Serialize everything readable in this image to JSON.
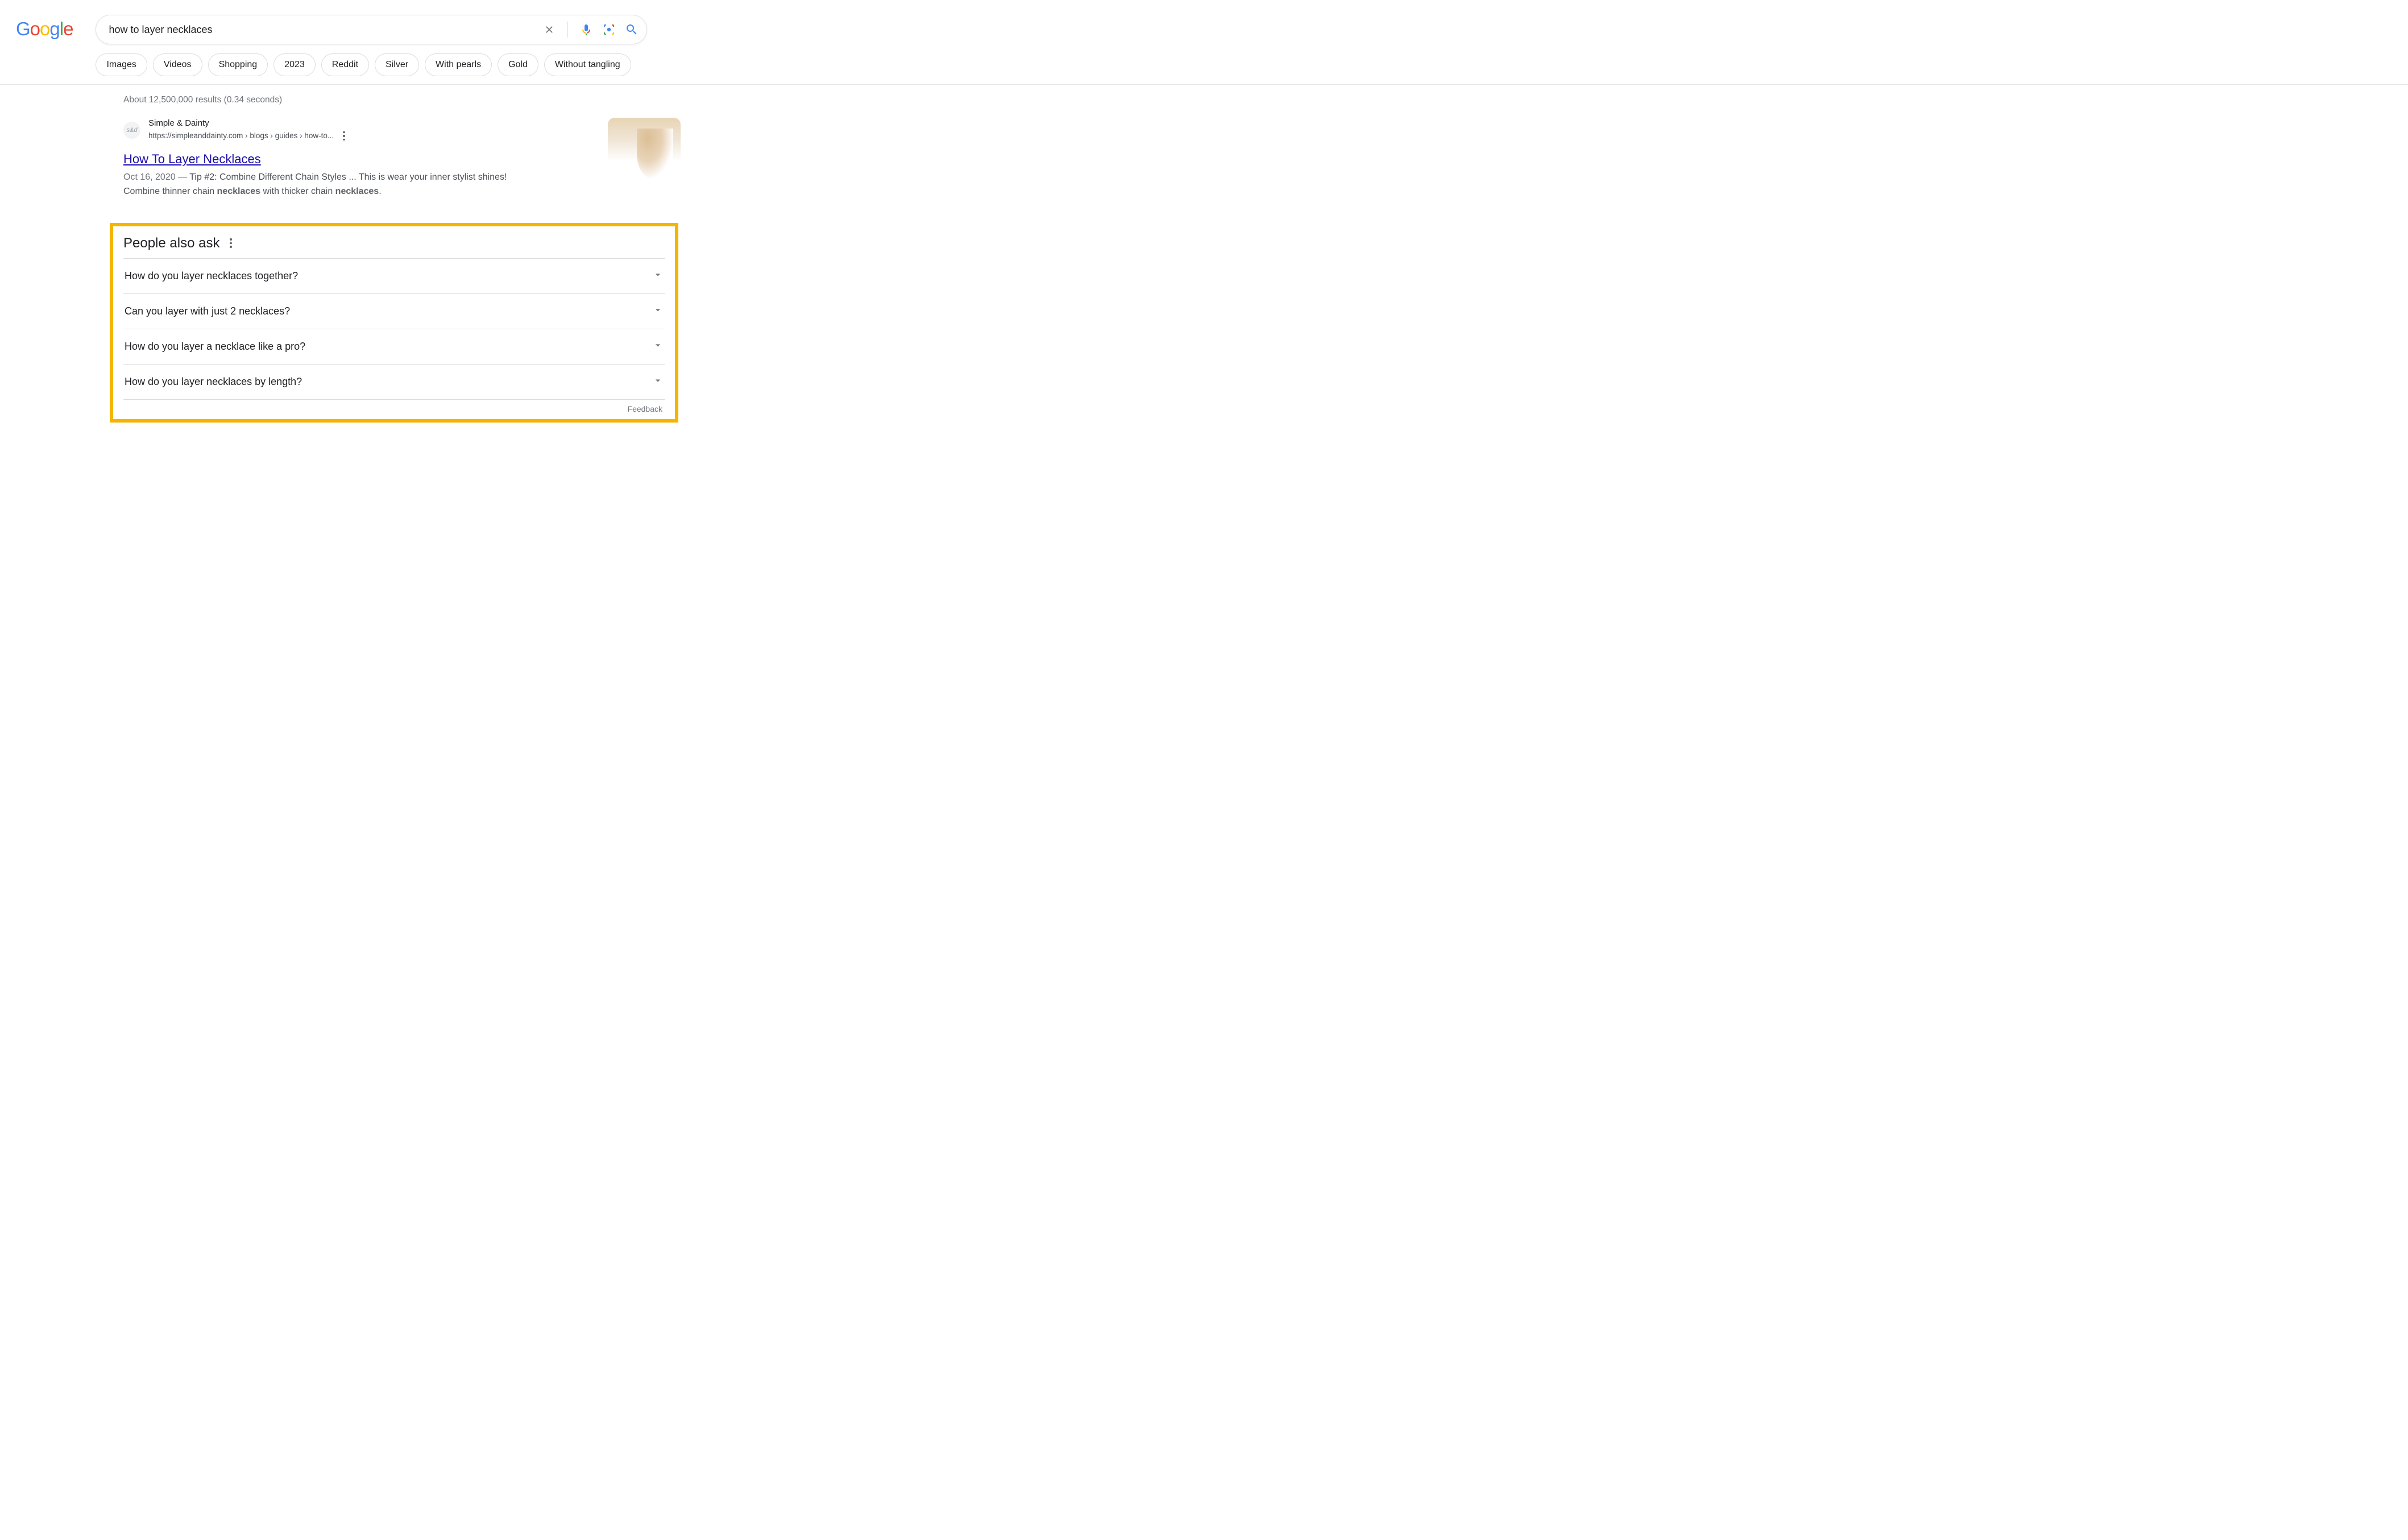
{
  "search": {
    "query": "how to layer necklaces"
  },
  "filters": [
    "Images",
    "Videos",
    "Shopping",
    "2023",
    "Reddit",
    "Silver",
    "With pearls",
    "Gold",
    "Without tangling"
  ],
  "stats": "About 12,500,000 results (0.34 seconds)",
  "result": {
    "site_name": "Simple & Dainty",
    "favicon_text": "s&d",
    "breadcrumb": "https://simpleanddainty.com › blogs › guides › how-to...",
    "title": "How To Layer Necklaces",
    "date": "Oct 16, 2020",
    "snippet_before": "Tip #2: Combine Different Chain Styles ... This is wear your inner stylist shines! Combine thinner chain ",
    "bold1": "necklaces",
    "snippet_mid": " with thicker chain ",
    "bold2": "necklaces",
    "snippet_after": "."
  },
  "paa": {
    "title": "People also ask",
    "items": [
      "How do you layer necklaces together?",
      "Can you layer with just 2 necklaces?",
      "How do you layer a necklace like a pro?",
      "How do you layer necklaces by length?"
    ],
    "feedback": "Feedback"
  }
}
